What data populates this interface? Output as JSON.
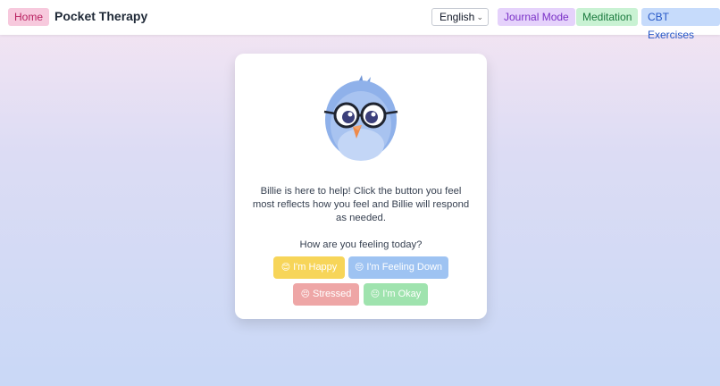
{
  "nav": {
    "home_label": "Home",
    "brand": "Pocket Therapy",
    "language": "English",
    "journal_label": "Journal Mode",
    "meditation_label": "Meditation",
    "cbt_label": "CBT Exercises"
  },
  "card": {
    "avatar_icon": "bird-with-glasses",
    "intro": "Billie is here to help! Click the button you feel most reflects how you feel and Billie will respond as needed.",
    "question": "How are you feeling today?",
    "moods": [
      {
        "emoji": "😊",
        "label": "I'm Happy"
      },
      {
        "emoji": "😔",
        "label": "I'm Feeling Down"
      },
      {
        "emoji": "😣",
        "label": "Stressed"
      },
      {
        "emoji": "😐",
        "label": "I'm Okay"
      }
    ]
  },
  "colors": {
    "home": "#f7c9dd",
    "journal": "#e5d2fb",
    "meditation": "#c9f2d3",
    "cbt": "#c6dbfb",
    "happy": "#f7d559",
    "down": "#9ec3f2",
    "stressed": "#eea6a6",
    "okay": "#9fe3ae"
  }
}
